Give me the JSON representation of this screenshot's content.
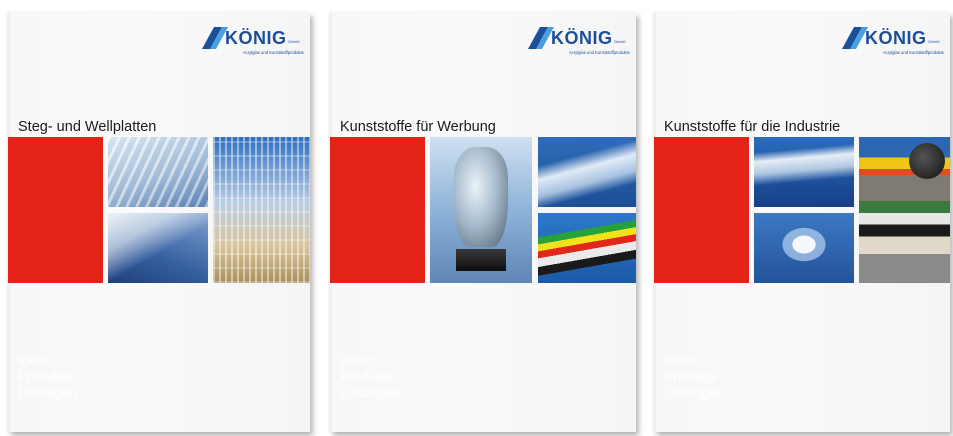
{
  "brand": {
    "name": "KÖNIG",
    "suffix": "GmbH",
    "tagline": "Acrylglas und Kunststoffprodukte",
    "color": "#1b4f9c",
    "accent": "#e42318"
  },
  "covers": [
    {
      "title": "Steg- und Wellplatten",
      "slogan": [
        "Ideen",
        "Produkte",
        "Lösungen"
      ],
      "photos": [
        "corrugated-sheets-photo",
        "multiwall-sheet-photo",
        "multiwall-stack-photo"
      ]
    },
    {
      "title": "Kunststoffe für Werbung",
      "slogan": [
        "Ideen",
        "Produkte",
        "Lösungen"
      ],
      "photos": [
        "acrylic-torso-sculpture-photo",
        "clear-acrylic-sheets-photo",
        "colored-acrylic-sheets-photo"
      ]
    },
    {
      "title": "Kunststoffe für die Industrie",
      "slogan": [
        "Ideen",
        "Produkte",
        "Lösungen"
      ],
      "photos": [
        "clear-sheets-photo",
        "machined-acrylic-parts-photo",
        "industrial-plastics-stack-photo"
      ]
    }
  ]
}
